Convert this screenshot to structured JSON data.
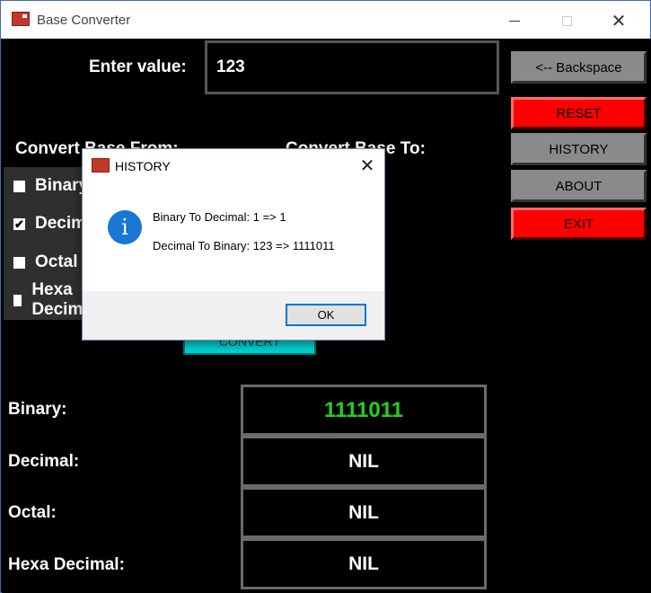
{
  "window": {
    "title": "Base Converter",
    "controls": {
      "minimize": "minimize",
      "maximize": "maximize",
      "close": "✕"
    }
  },
  "input": {
    "label": "Enter value:",
    "value": "123"
  },
  "side_buttons": [
    {
      "label": "<-- Backspace",
      "color": "grey"
    },
    {
      "label": "RESET",
      "color": "red"
    },
    {
      "label": "HISTORY",
      "color": "grey"
    },
    {
      "label": "ABOUT",
      "color": "grey"
    },
    {
      "label": "EXIT",
      "color": "red"
    }
  ],
  "convert_from": {
    "heading": "Convert Base From:",
    "options": [
      {
        "label": "Binary",
        "checked": false
      },
      {
        "label": "Decimal",
        "checked": true
      },
      {
        "label": "Octal",
        "checked": false
      },
      {
        "label": "Hexa Decimal",
        "checked": false
      }
    ]
  },
  "convert_to": {
    "heading": "Convert Base To:"
  },
  "convert_button": "CONVERT",
  "results": [
    {
      "label": "Binary:",
      "value": "1111011",
      "highlight": true
    },
    {
      "label": "Decimal:",
      "value": "NIL",
      "highlight": false
    },
    {
      "label": "Octal:",
      "value": "NIL",
      "highlight": false
    },
    {
      "label": "Hexa Decimal:",
      "value": "NIL",
      "highlight": false
    }
  ],
  "dialog": {
    "title": "HISTORY",
    "close": "✕",
    "icon": "info-icon",
    "icon_glyph": "i",
    "lines": [
      "Binary To Decimal: 1 => 1",
      "Decimal To Binary: 123 => 1111011"
    ],
    "ok_label": "OK"
  },
  "colors": {
    "red_button": "#ff0000",
    "grey_button": "#8a8a8a",
    "convert_button": "#00d8d8",
    "result_highlight": "#22d022",
    "info_icon": "#1976d2"
  }
}
